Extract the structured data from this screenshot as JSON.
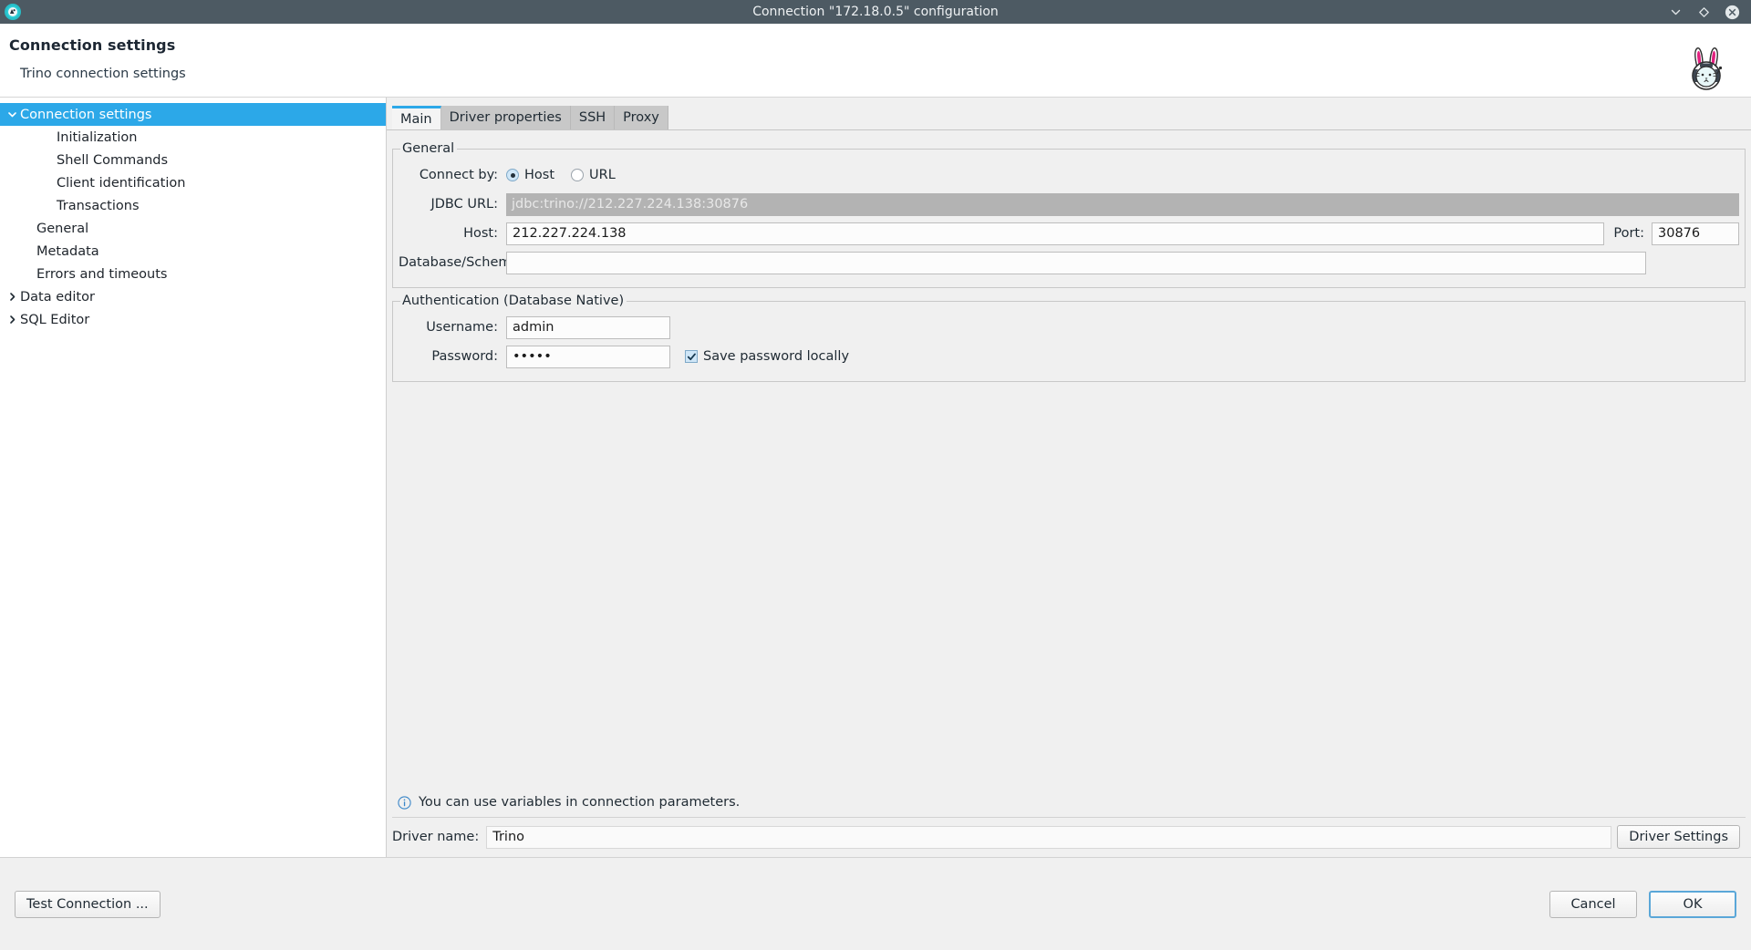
{
  "window": {
    "title": "Connection \"172.18.0.5\" configuration",
    "app_icon": "dbeaver-icon",
    "controls": [
      {
        "name": "minimize-button",
        "glyph": "chevron-down-icon"
      },
      {
        "name": "maximize-button",
        "glyph": "diamond-icon"
      },
      {
        "name": "close-button",
        "glyph": "circle-close-icon"
      }
    ]
  },
  "header": {
    "title": "Connection settings",
    "subtitle": "Trino connection settings",
    "logo": "rabbit-astronaut-logo"
  },
  "sidebar": {
    "items": [
      {
        "label": "Connection settings",
        "level": 1,
        "arrow": "expanded",
        "selected": true
      },
      {
        "label": "Initialization",
        "level": 2,
        "arrow": "none",
        "selected": false
      },
      {
        "label": "Shell Commands",
        "level": 2,
        "arrow": "none",
        "selected": false
      },
      {
        "label": "Client identification",
        "level": 2,
        "arrow": "none",
        "selected": false
      },
      {
        "label": "Transactions",
        "level": 2,
        "arrow": "none",
        "selected": false
      },
      {
        "label": "General",
        "level": 1,
        "arrow": "none",
        "selected": false
      },
      {
        "label": "Metadata",
        "level": 1,
        "arrow": "none",
        "selected": false
      },
      {
        "label": "Errors and timeouts",
        "level": 1,
        "arrow": "none",
        "selected": false
      },
      {
        "label": "Data editor",
        "level": 1,
        "arrow": "collapsed",
        "selected": false
      },
      {
        "label": "SQL Editor",
        "level": 1,
        "arrow": "collapsed",
        "selected": false
      }
    ]
  },
  "tabs": [
    {
      "label": "Main",
      "active": true
    },
    {
      "label": "Driver properties",
      "active": false
    },
    {
      "label": "SSH",
      "active": false
    },
    {
      "label": "Proxy",
      "active": false
    }
  ],
  "general": {
    "legend": "General",
    "connect_by_label": "Connect by:",
    "radio_host_label": "Host",
    "radio_url_label": "URL",
    "radio_selected": "Host",
    "jdbc_url_label": "JDBC URL:",
    "jdbc_url_value": "jdbc:trino://212.227.224.138:30876",
    "host_label": "Host:",
    "host_value": "212.227.224.138",
    "host_placeholder": "",
    "port_label": "Port:",
    "port_value": "30876",
    "schema_label": "Database/Schema:",
    "schema_value": "",
    "schema_placeholder": ""
  },
  "authentication": {
    "legend": "Authentication (Database Native)",
    "username_label": "Username:",
    "username_value": "admin",
    "username_placeholder": "",
    "password_label": "Password:",
    "password_value": "•••••",
    "password_placeholder": "",
    "save_password_label": "Save password locally",
    "save_password_checked": true
  },
  "info": {
    "icon": "info-icon",
    "text": "You can use variables in connection parameters."
  },
  "driver": {
    "name_label": "Driver name:",
    "name_value": "Trino",
    "settings_button": "Driver Settings"
  },
  "footer": {
    "test_connection": "Test Connection ...",
    "cancel": "Cancel",
    "ok": "OK"
  },
  "colors": {
    "titlebar": "#4d5a63",
    "accent": "#2ca8e8",
    "selection": "#2ca8e8",
    "panel": "#f0f0f0",
    "disabled_field": "#b3b3b3",
    "default_button_border": "#5aa7d8"
  }
}
